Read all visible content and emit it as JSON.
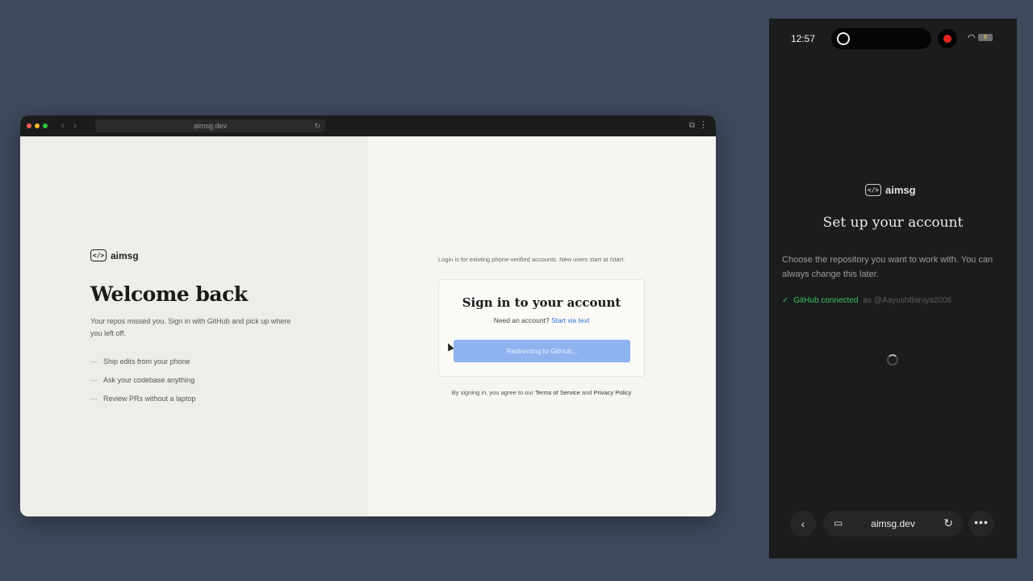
{
  "browser": {
    "url": "aimsg.dev",
    "nav_back": "‹",
    "nav_forward": "›",
    "reload": "↻",
    "extensions": "⧉",
    "menu": "⋮"
  },
  "left": {
    "brand_icon": "</>",
    "brand_name": "aimsg",
    "title": "Welcome back",
    "subtitle": "Your repos missed you. Sign in with GitHub and pick up where you left off.",
    "features": [
      "Ship edits from your phone",
      "Ask your codebase anything",
      "Review PRs without a laptop"
    ],
    "feature_dash": "—"
  },
  "login": {
    "note": "Login is for existing phone-verified accounts. New users start at /start.",
    "title": "Sign in to your account",
    "need_account": "Need an account?",
    "start_link": "Start via text",
    "button": "Redirecting to GitHub...",
    "terms_prefix": "By signing in, you agree to our",
    "terms_link": "Terms of Service",
    "terms_and": "and",
    "privacy_link": "Privacy Policy"
  },
  "phone": {
    "time": "12:57",
    "battery": "9",
    "brand_icon": "</>",
    "brand_name": "aimsg",
    "title": "Set up your account",
    "description": "Choose the repository you want to work with. You can always change this later.",
    "github_connected": "GitHub connected",
    "as_user": "as @AayushBaniya2006",
    "check_icon": "✓",
    "address": "aimsg.dev",
    "back_icon": "‹",
    "tabs_icon": "▭",
    "reload_icon": "↻",
    "more_icon": "•••"
  }
}
